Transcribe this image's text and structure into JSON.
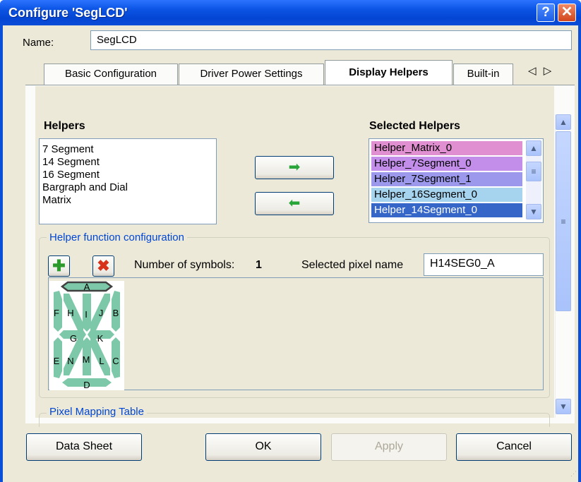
{
  "window": {
    "title": "Configure 'SegLCD'",
    "help_glyph": "?",
    "close_glyph": "✕"
  },
  "name": {
    "label": "Name:",
    "value": "SegLCD"
  },
  "tabs": [
    {
      "label": "Basic Configuration"
    },
    {
      "label": "Driver Power Settings"
    },
    {
      "label": "Display Helpers",
      "active": true
    },
    {
      "label": "Built-in"
    }
  ],
  "tab_scroll_glyph": "◁ ▷",
  "helpers": {
    "heading": "Helpers",
    "items": [
      "7 Segment",
      "14 Segment",
      "16 Segment",
      "Bargraph and Dial",
      "Matrix"
    ]
  },
  "selected_helpers": {
    "heading": "Selected Helpers",
    "items": [
      {
        "label": "Helper_Matrix_0",
        "color": "#e08fd0"
      },
      {
        "label": "Helper_7Segment_0",
        "color": "#c28ee9"
      },
      {
        "label": "Helper_7Segment_1",
        "color": "#9c98ec"
      },
      {
        "label": "Helper_16Segment_0",
        "color": "#a6d3ee"
      },
      {
        "label": "Helper_14Segment_0",
        "color": "#3566c8",
        "selected": true
      }
    ]
  },
  "move_buttons": {
    "add_glyph": "➡",
    "remove_glyph": "⬅"
  },
  "helper_config": {
    "title": "Helper function configuration",
    "num_symbols_label": "Number of symbols:",
    "num_symbols": "1",
    "pixel_name_label": "Selected pixel name",
    "pixel_name": "H14SEG0_A"
  },
  "segments": {
    "labels": [
      "A",
      "F",
      "H",
      "I",
      "J",
      "B",
      "G",
      "K",
      "E",
      "N",
      "M",
      "L",
      "C",
      "D"
    ],
    "selected": "A",
    "color": "#7cc8a8"
  },
  "pixel_mapping": {
    "title": "Pixel Mapping Table"
  },
  "buttons": {
    "datasheet": "Data Sheet",
    "ok": "OK",
    "apply": "Apply",
    "cancel": "Cancel"
  }
}
